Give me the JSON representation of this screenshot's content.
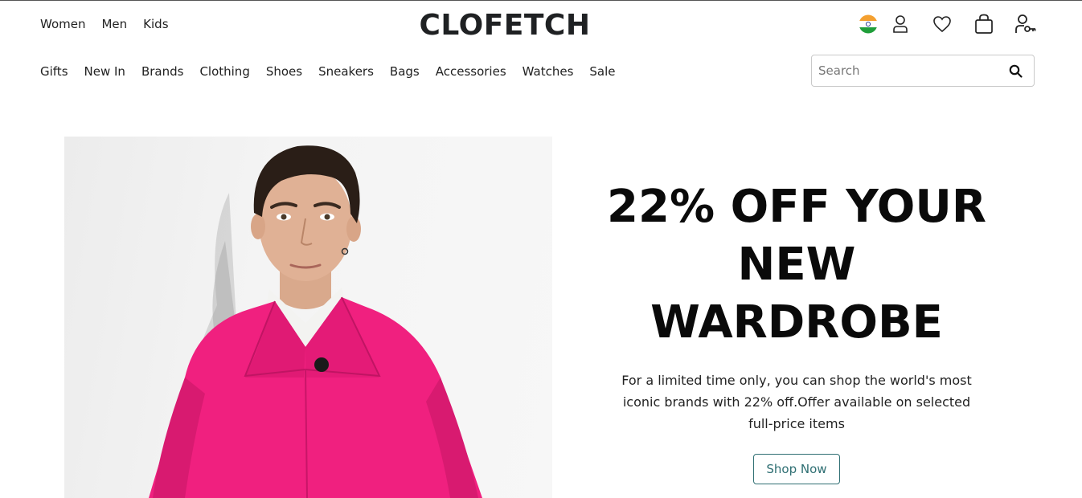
{
  "header": {
    "gender_nav": [
      "Women",
      "Men",
      "Kids"
    ],
    "logo": "CLOFETCH",
    "icons": [
      "india-flag-icon",
      "user-icon",
      "heart-icon",
      "bag-icon",
      "user-key-icon"
    ]
  },
  "category_nav": [
    "Gifts",
    "New In",
    "Brands",
    "Clothing",
    "Shoes",
    "Sneakers",
    "Bags",
    "Accessories",
    "Watches",
    "Sale"
  ],
  "search": {
    "placeholder": "Search",
    "value": ""
  },
  "hero": {
    "headline_line1": "22% OFF YOUR",
    "headline_line2": "NEW WARDROBE",
    "subtext": "For a limited time only, you can shop the world's most iconic brands with 22% off.Offer available on selected full-price items",
    "cta": "Shop Now"
  },
  "colors": {
    "accent": "#2f6f73",
    "coat_pink": "#f0207f",
    "text": "#222222"
  }
}
